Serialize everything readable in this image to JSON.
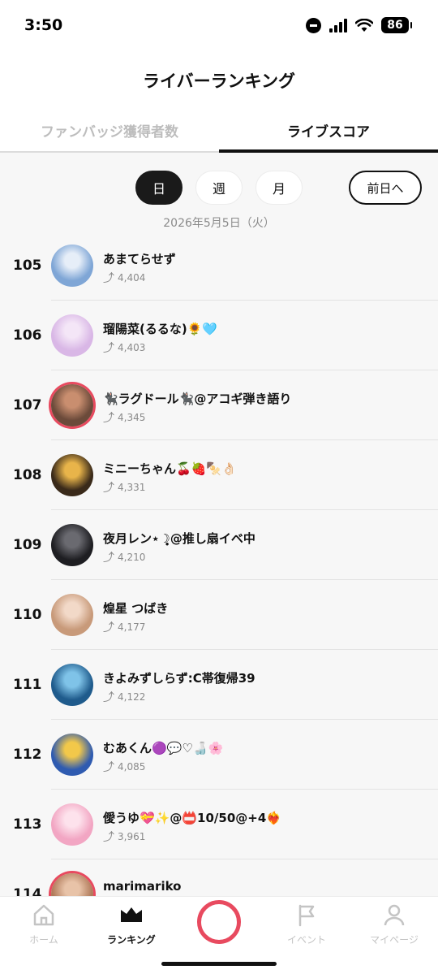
{
  "status_bar": {
    "time": "3:50",
    "battery": "86"
  },
  "header": {
    "title": "ライバーランキング"
  },
  "tabs": [
    {
      "label": "ファンバッジ獲得者数",
      "active": false
    },
    {
      "label": "ライブスコア",
      "active": true
    }
  ],
  "period": {
    "day": "日",
    "week": "週",
    "month": "月",
    "selected": "day",
    "prev_label": "前日へ"
  },
  "date": "2026年5月5日（火）",
  "rankings": [
    {
      "rank": "105",
      "name": "あまてらせず",
      "score": "4,404",
      "live": false,
      "avatar_color": "#7fa6d6",
      "avatar_accent": "#e6eef8"
    },
    {
      "rank": "106",
      "name": "瑠陽菜(るるな)🌻🩵",
      "score": "4,403",
      "live": false,
      "avatar_color": "#d9b7e6",
      "avatar_accent": "#f4e6f7"
    },
    {
      "rank": "107",
      "name": "🐈‍⬛ラグドール🐈‍⬛@アコギ弾き語り",
      "score": "4,345",
      "live": true,
      "avatar_color": "#6b4a3a",
      "avatar_accent": "#c98e6f"
    },
    {
      "rank": "108",
      "name": "ミニーちゃん🍒🍓🍢👌🏻",
      "score": "4,331",
      "live": false,
      "avatar_color": "#3a2a1a",
      "avatar_accent": "#e8b44a"
    },
    {
      "rank": "109",
      "name": "夜月レン⋆☽̣̣̥@推し扇イベ中",
      "score": "4,210",
      "live": false,
      "avatar_color": "#1e1e22",
      "avatar_accent": "#6a6a70"
    },
    {
      "rank": "110",
      "name": "煌星 つばき",
      "score": "4,177",
      "live": false,
      "avatar_color": "#c89a7a",
      "avatar_accent": "#f2d9c8"
    },
    {
      "rank": "111",
      "name": "きよみずしらず:C帯復帰39",
      "score": "4,122",
      "live": false,
      "avatar_color": "#1f5b8c",
      "avatar_accent": "#7fc3e8"
    },
    {
      "rank": "112",
      "name": "むあくん🟣💬♡🍶🌸",
      "score": "4,085",
      "live": false,
      "avatar_color": "#2f5bb0",
      "avatar_accent": "#f2c84a"
    },
    {
      "rank": "113",
      "name": "僾うゆ💝✨@📛10/50@+4❤️‍🔥",
      "score": "3,961",
      "live": false,
      "avatar_color": "#f2a6c3",
      "avatar_accent": "#fde2ec"
    },
    {
      "rank": "114",
      "name": "marimariko",
      "score": "",
      "live": true,
      "avatar_color": "#b07a5a",
      "avatar_accent": "#e8c3a8"
    }
  ],
  "bottom_nav": {
    "home": "ホーム",
    "ranking": "ランキング",
    "event": "イベント",
    "mypage": "マイページ"
  }
}
